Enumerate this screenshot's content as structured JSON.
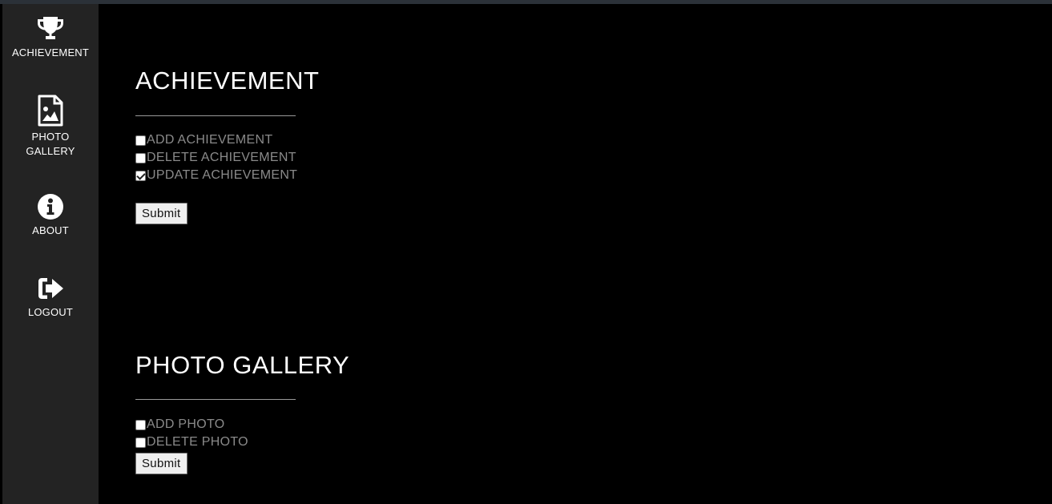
{
  "sidebar": {
    "items": [
      {
        "label": "ACHIEVEMENT",
        "icon": "trophy-icon"
      },
      {
        "label_line1": "PHOTO",
        "label_line2": "GALLERY",
        "icon": "image-file-icon"
      },
      {
        "label": "ABOUT",
        "icon": "info-circle-icon"
      },
      {
        "label": "LOGOUT",
        "icon": "sign-out-icon"
      }
    ]
  },
  "achievement": {
    "title": "ACHIEVEMENT",
    "options": [
      {
        "label": "ADD ACHIEVEMENT",
        "checked": false
      },
      {
        "label": "DELETE ACHIEVEMENT",
        "checked": false
      },
      {
        "label": "UPDATE ACHIEVEMENT",
        "checked": true
      }
    ],
    "submit_label": "Submit"
  },
  "photo_gallery": {
    "title": "PHOTO GALLERY",
    "options": [
      {
        "label": "ADD PHOTO",
        "checked": false
      },
      {
        "label": "DELETE PHOTO",
        "checked": false
      }
    ],
    "submit_label": "Submit"
  },
  "colors": {
    "background": "#000000",
    "sidebar": "#232323",
    "text": "#ffffff",
    "option_text": "#8a8a8a"
  }
}
